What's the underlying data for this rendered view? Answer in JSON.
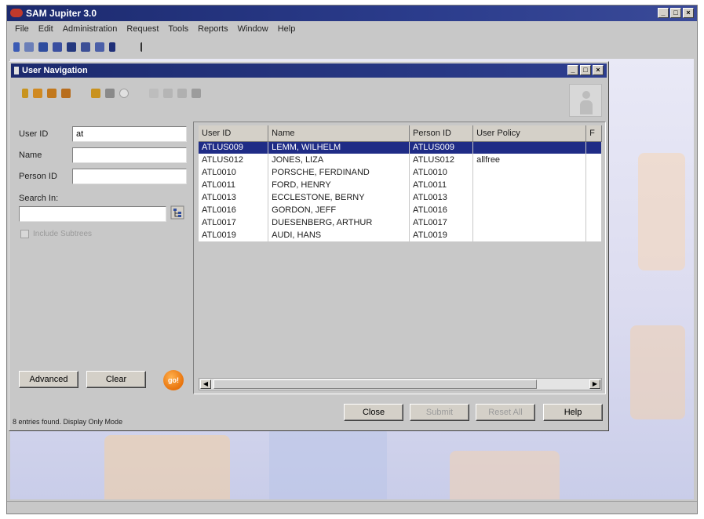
{
  "app": {
    "title": "SAM Jupiter 3.0",
    "window_controls": [
      "_",
      "□",
      "×"
    ]
  },
  "menu": [
    "File",
    "Edit",
    "Administration",
    "Request",
    "Tools",
    "Reports",
    "Window",
    "Help"
  ],
  "app_toolbar_icons": [
    "info-icon",
    "grid-icon",
    "chart-icon",
    "users-icon",
    "calendar-icon",
    "building-icon",
    "group-icon",
    "book-icon",
    "pointer-icon"
  ],
  "dialog": {
    "title": "User Navigation",
    "window_controls": [
      "_",
      "□",
      "×"
    ],
    "toolbar_icons": [
      "person-key-icon",
      "person-add-icon",
      "person-edit-icon",
      "person-delete-icon",
      "tree-icon",
      "refresh-icon",
      "info-icon",
      "undo-icon",
      "cut-icon",
      "copy-icon",
      "print-icon"
    ],
    "form": {
      "user_id_label": "User ID",
      "user_id_value": "at",
      "name_label": "Name",
      "name_value": "",
      "person_id_label": "Person ID",
      "person_id_value": "",
      "search_in_label": "Search In:",
      "search_in_value": "",
      "include_subtrees_label": "Include Subtrees"
    },
    "buttons": {
      "advanced": "Advanced",
      "clear": "Clear",
      "go": "go!",
      "close": "Close",
      "submit": "Submit",
      "reset_all": "Reset All",
      "help": "Help"
    },
    "table": {
      "columns": [
        "User ID",
        "Name",
        "Person ID",
        "User Policy",
        "F"
      ],
      "rows": [
        [
          "ATLUS009",
          "LEMM, WILHELM",
          "ATLUS009",
          "",
          ""
        ],
        [
          "ATLUS012",
          "JONES, LIZA",
          "ATLUS012",
          "allfree",
          ""
        ],
        [
          "ATL0010",
          "PORSCHE, FERDINAND",
          "ATL0010",
          "",
          ""
        ],
        [
          "ATL0011",
          "FORD, HENRY",
          "ATL0011",
          "",
          ""
        ],
        [
          "ATL0013",
          "ECCLESTONE, BERNY",
          "ATL0013",
          "",
          ""
        ],
        [
          "ATL0016",
          "GORDON, JEFF",
          "ATL0016",
          "",
          ""
        ],
        [
          "ATL0017",
          "DUESENBERG, ARTHUR",
          "ATL0017",
          "",
          ""
        ],
        [
          "ATL0019",
          "AUDI, HANS",
          "ATL0019",
          "",
          ""
        ]
      ],
      "selected_row": 0
    },
    "status": "8 entries found. Display Only Mode"
  },
  "colors": {
    "titlebar": "#1c2a6e",
    "selection": "#1f2c86",
    "go_button": "#e8730c"
  }
}
